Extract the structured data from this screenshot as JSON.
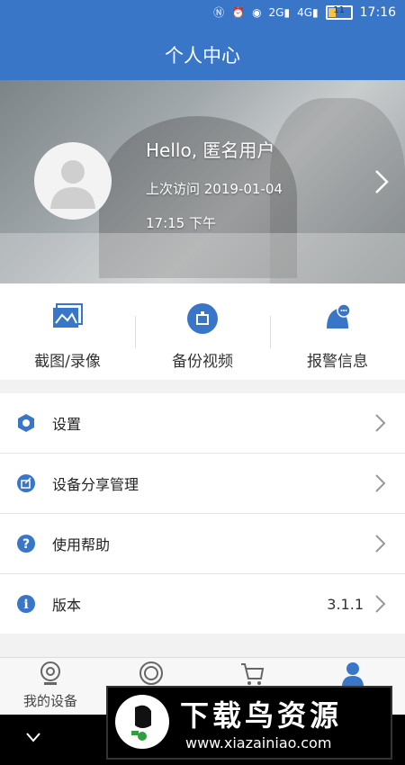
{
  "status_bar": {
    "time": "17:16",
    "signal1": "2G",
    "signal2": "4G",
    "battery": "11",
    "icons": [
      "nfc-icon",
      "alarm-icon",
      "eye-icon",
      "signal-icon",
      "signal-icon",
      "battery-icon"
    ]
  },
  "app_bar": {
    "title": "个人中心"
  },
  "profile": {
    "greeting": "Hello, 匿名用户",
    "last_visit": "上次访问 2019-01-04",
    "time": "17:15 下午"
  },
  "quick_actions": [
    {
      "label": "截图/录像",
      "icon": "screenshot-icon"
    },
    {
      "label": "备份视频",
      "icon": "backup-video-icon"
    },
    {
      "label": "报警信息",
      "icon": "alarm-bell-icon"
    }
  ],
  "menu": [
    {
      "label": "设置",
      "icon": "settings-icon",
      "value": ""
    },
    {
      "label": "设备分享管理",
      "icon": "share-icon",
      "value": ""
    },
    {
      "label": "使用帮助",
      "icon": "help-icon",
      "value": ""
    },
    {
      "label": "版本",
      "icon": "info-icon",
      "value": "3.1.1"
    }
  ],
  "tabs": [
    {
      "label": "我的设备",
      "icon": "camera-icon",
      "active": false
    },
    {
      "label": "",
      "icon": "cloud-disc-icon",
      "active": false
    },
    {
      "label": "",
      "icon": "cart-icon",
      "active": false
    },
    {
      "label": "",
      "icon": "user-icon",
      "active": true
    }
  ],
  "watermark": {
    "title": "下载鸟资源",
    "url": "www.xiazainiao.com"
  },
  "colors": {
    "primary": "#3a76c8",
    "text": "#222222",
    "chevron": "#999999"
  }
}
